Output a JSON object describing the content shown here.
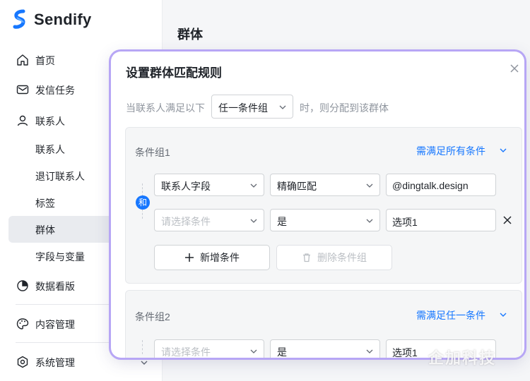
{
  "app": {
    "name": "Sendify",
    "brand_color": "#1677ff"
  },
  "sidebar": {
    "items": [
      {
        "label": "首页",
        "icon": "home-icon"
      },
      {
        "label": "发信任务",
        "icon": "mail-icon"
      },
      {
        "label": "联系人",
        "icon": "user-icon"
      },
      {
        "label": "联系人"
      },
      {
        "label": "退订联系人"
      },
      {
        "label": "标签"
      },
      {
        "label": "群体",
        "active": true
      },
      {
        "label": "字段与变量"
      },
      {
        "label": "数据看版",
        "icon": "pie-chart-icon"
      },
      {
        "label": "内容管理",
        "icon": "palette-icon"
      },
      {
        "label": "系统管理",
        "icon": "settings-icon"
      }
    ]
  },
  "main": {
    "title": "群体"
  },
  "modal": {
    "title": "设置群体匹配规则",
    "rule_lead": "当联系人满足以下",
    "rule_select": "任一条件组",
    "rule_tail": "时，则分配到该群体",
    "group1": {
      "title": "条件组1",
      "mode": "需满足所有条件",
      "and_label": "和",
      "rows": [
        {
          "field": "联系人字段",
          "operator": "精确匹配",
          "value": "@dingtalk.design"
        },
        {
          "field_placeholder": "请选择条件",
          "operator": "是",
          "value": "选项1"
        }
      ],
      "add_button": "新增条件",
      "delete_button": "删除条件组"
    },
    "group2": {
      "title": "条件组2",
      "mode": "需满足任一条件",
      "rows": [
        {
          "field_placeholder": "请选择条件",
          "operator": "是",
          "value": "选项1"
        }
      ]
    }
  },
  "watermark": "企加科技"
}
